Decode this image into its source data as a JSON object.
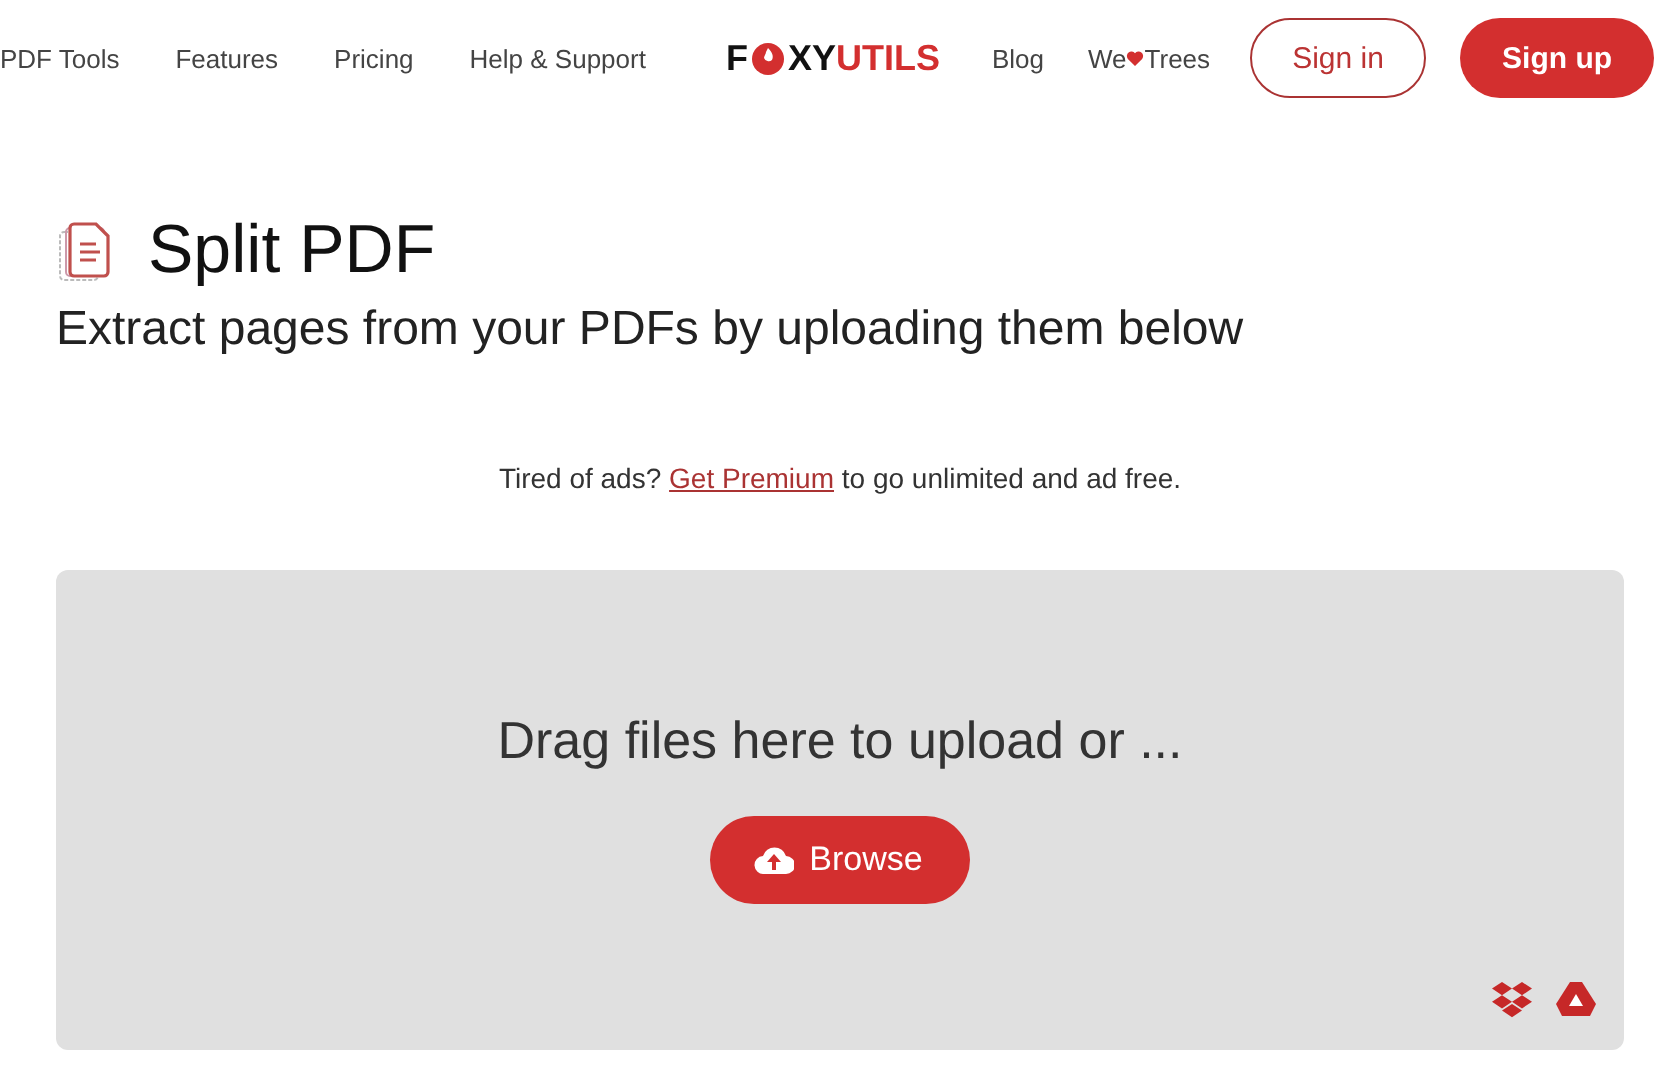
{
  "nav": {
    "links": [
      "PDF Tools",
      "Features",
      "Pricing",
      "Help & Support"
    ],
    "logo": {
      "lead": "F",
      "middle": "XY",
      "accent": "UTILS"
    },
    "right_links": [
      {
        "kind": "text",
        "label": "Blog"
      },
      {
        "kind": "heart",
        "before": "We",
        "after": "Trees"
      }
    ],
    "buttons": [
      {
        "kind": "outline",
        "label": "Sign in"
      },
      {
        "kind": "solid",
        "label": "Sign up"
      }
    ]
  },
  "heading": {
    "title": "Split PDF",
    "subtitle": "Extract pages from your PDFs by uploading them below"
  },
  "promo": {
    "before": "Tired of ads?",
    "link": "Get Premium",
    "after": "to go unlimited and ad free."
  },
  "upload": {
    "prompt": "Drag files here to upload or ...",
    "button": "Browse"
  }
}
